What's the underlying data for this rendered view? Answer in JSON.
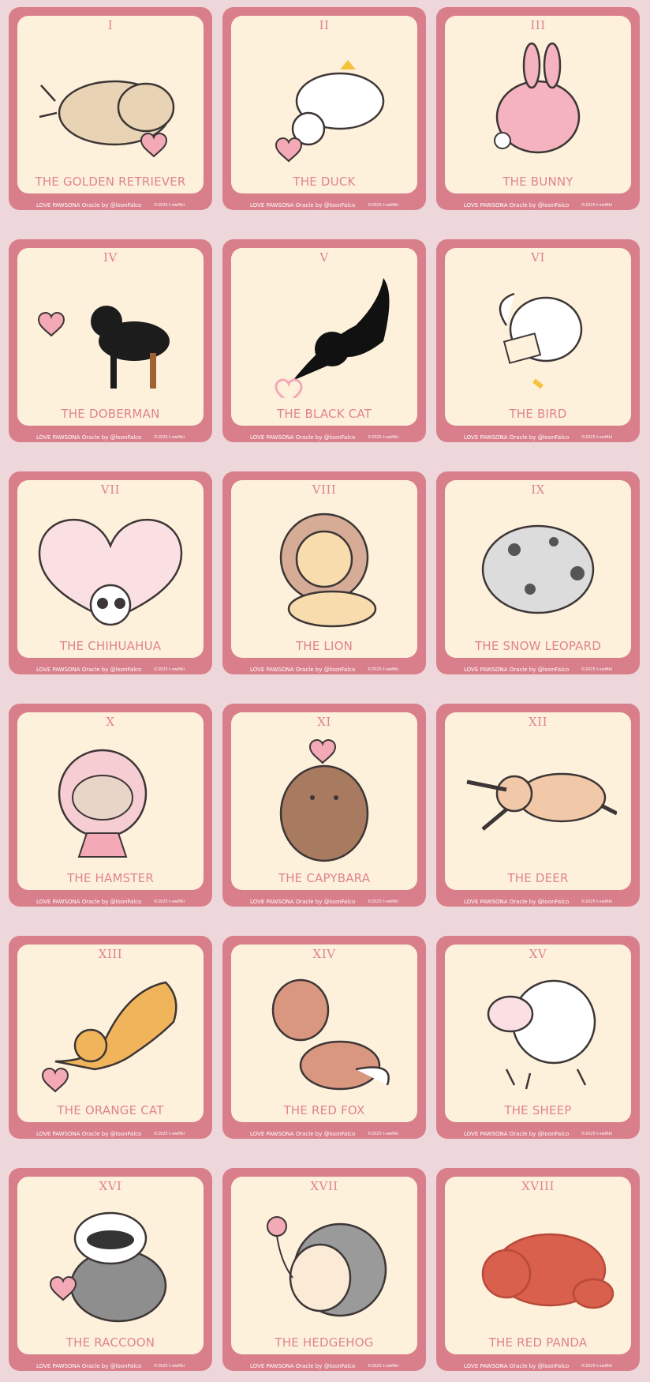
{
  "deck": {
    "footer_brand": "LOVE PAWSONA Oracle by @loonFalco",
    "footer_copyright": "©2025 t-swiftki",
    "colors": {
      "page_background": "#eed7da",
      "card_frame": "#d97f8b",
      "card_face": "#fdf1dc",
      "label_pink": "#e0838f"
    }
  },
  "cards": [
    {
      "numeral": "I",
      "title": "THE GOLDEN RETRIEVER",
      "icon": "golden-retriever-illustration",
      "accent": "#e8d3b4"
    },
    {
      "numeral": "II",
      "title": "THE DUCK",
      "icon": "duck-illustration",
      "accent": "#ffffff"
    },
    {
      "numeral": "III",
      "title": "THE BUNNY",
      "icon": "bunny-illustration",
      "accent": "#f4b3bf"
    },
    {
      "numeral": "IV",
      "title": "THE DOBERMAN",
      "icon": "doberman-illustration",
      "accent": "#1c1c1c"
    },
    {
      "numeral": "V",
      "title": "THE BLACK CAT",
      "icon": "black-cat-illustration",
      "accent": "#111111"
    },
    {
      "numeral": "VI",
      "title": "THE BIRD",
      "icon": "bird-illustration",
      "accent": "#ffffff"
    },
    {
      "numeral": "VII",
      "title": "THE CHIHUAHUA",
      "icon": "chihuahua-illustration",
      "accent": "#fbe0e3"
    },
    {
      "numeral": "VIII",
      "title": "THE LION",
      "icon": "lion-illustration",
      "accent": "#d6ac97"
    },
    {
      "numeral": "IX",
      "title": "THE SNOW LEOPARD",
      "icon": "snow-leopard-illustration",
      "accent": "#dcdcdc"
    },
    {
      "numeral": "X",
      "title": "THE HAMSTER",
      "icon": "hamster-illustration",
      "accent": "#f6cdd3"
    },
    {
      "numeral": "XI",
      "title": "THE CAPYBARA",
      "icon": "capybara-illustration",
      "accent": "#a87a60"
    },
    {
      "numeral": "XII",
      "title": "THE DEER",
      "icon": "deer-illustration",
      "accent": "#f2c9a8"
    },
    {
      "numeral": "XIII",
      "title": "THE ORANGE CAT",
      "icon": "orange-cat-illustration",
      "accent": "#f0b45a"
    },
    {
      "numeral": "XIV",
      "title": "THE RED FOX",
      "icon": "red-fox-illustration",
      "accent": "#d9977f"
    },
    {
      "numeral": "XV",
      "title": "THE SHEEP",
      "icon": "sheep-illustration",
      "accent": "#ffffff"
    },
    {
      "numeral": "XVI",
      "title": "THE RACCOON",
      "icon": "raccoon-illustration",
      "accent": "#8e8e8e"
    },
    {
      "numeral": "XVII",
      "title": "THE HEDGEHOG",
      "icon": "hedgehog-illustration",
      "accent": "#9a9a9a"
    },
    {
      "numeral": "XVIII",
      "title": "THE RED PANDA",
      "icon": "red-panda-illustration",
      "accent": "#d9604d"
    }
  ]
}
